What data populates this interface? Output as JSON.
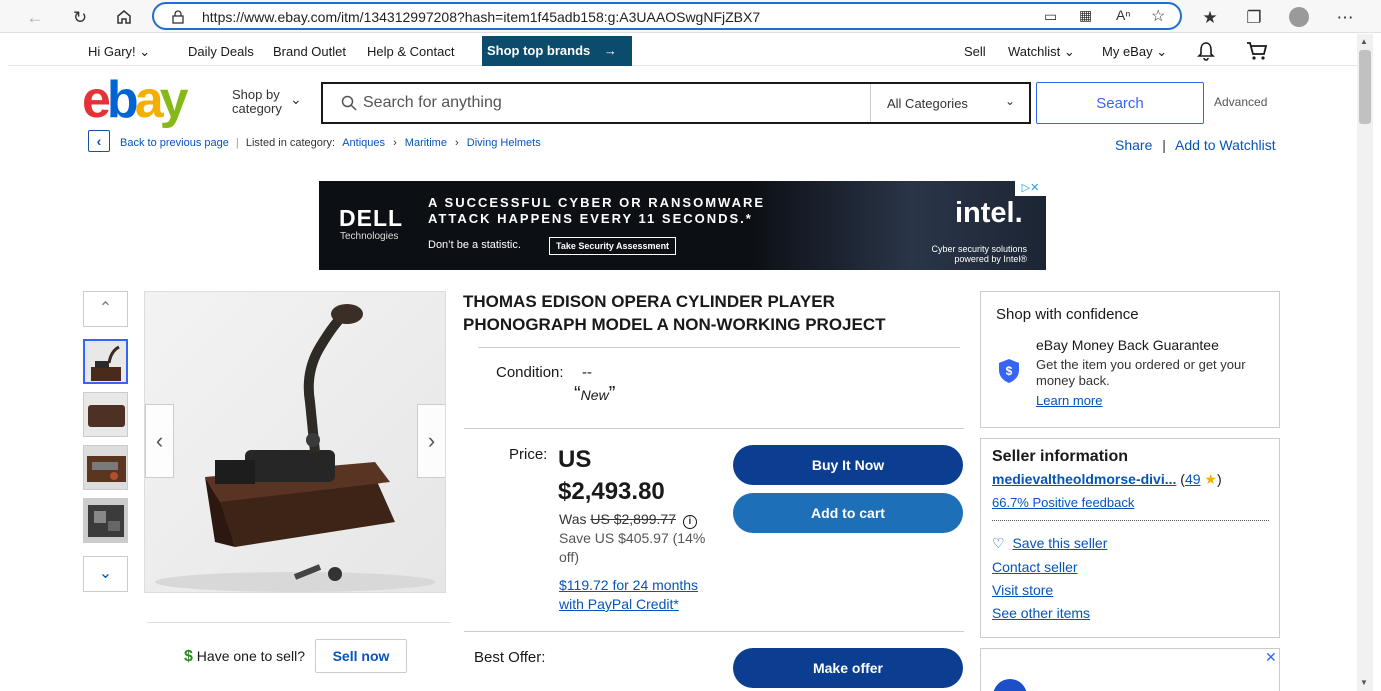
{
  "browser": {
    "url": "https://www.ebay.com/itm/134312997208?hash=item1f45adb158:g:A3UAAOSwgNFjZBX7"
  },
  "topnav": {
    "greeting": "Hi Gary!",
    "daily_deals": "Daily Deals",
    "brand_outlet": "Brand Outlet",
    "help": "Help & Contact",
    "shop_top": "Shop top brands",
    "sell": "Sell",
    "watchlist": "Watchlist",
    "myebay": "My eBay"
  },
  "header": {
    "logo_letters": [
      "e",
      "b",
      "a",
      "y"
    ],
    "logo_colors": [
      "#e53238",
      "#0064d2",
      "#f5af02",
      "#86b817"
    ],
    "shop_by_line1": "Shop by",
    "shop_by_line2": "category",
    "search_placeholder": "Search for anything",
    "category": "All Categories",
    "search_button": "Search",
    "advanced": "Advanced"
  },
  "breadcrumb": {
    "back": "Back to previous page",
    "listed_in": "Listed in category:",
    "items": [
      "Antiques",
      "Maritime",
      "Diving Helmets"
    ],
    "share": "Share",
    "add_watchlist": "Add to Watchlist"
  },
  "ad": {
    "brand": "DELL",
    "brand_sub": "Technologies",
    "headline": "A SUCCESSFUL CYBER OR RANSOMWARE\nATTACK HAPPENS EVERY 11 SECONDS.*",
    "tagline": "Don’t be a statistic.",
    "cta": "Take Security Assessment",
    "partner": "intel.",
    "partner_text": "Cyber security solutions powered by Intel®"
  },
  "listing": {
    "title": "THOMAS EDISON OPERA CYLINDER PLAYER PHONOGRAPH MODEL A NON-WORKING PROJECT",
    "condition_label": "Condition:",
    "condition_value": "--",
    "condition_quote": "New",
    "price_label": "Price:",
    "price_currency": "US",
    "price": "$2,493.80",
    "was_label": "Was",
    "was_price": "US $2,899.77",
    "save_text": "Save US $405.97 (14% off)",
    "credit_text": "$119.72 for 24 months with PayPal Credit*",
    "buy_now": "Buy It Now",
    "add_cart": "Add to cart",
    "best_offer_label": "Best Offer:",
    "make_offer": "Make offer",
    "have_one": "Have one to sell?",
    "sell_now": "Sell now"
  },
  "confidence": {
    "title": "Shop with confidence",
    "guarantee": "eBay Money Back Guarantee",
    "guarantee_desc": "Get the item you ordered or get your money back.",
    "learn_more": "Learn more"
  },
  "seller": {
    "title": "Seller information",
    "name": "medievaltheoldmorse-divi...",
    "score": "49",
    "feedback": "66.7% Positive feedback",
    "save": "Save this seller",
    "contact": "Contact seller",
    "visit": "Visit store",
    "other": "See other items"
  },
  "colors": {
    "primary_button": "#0b3d91",
    "secondary_button": "#1d6fb8",
    "link": "#0654ba"
  }
}
